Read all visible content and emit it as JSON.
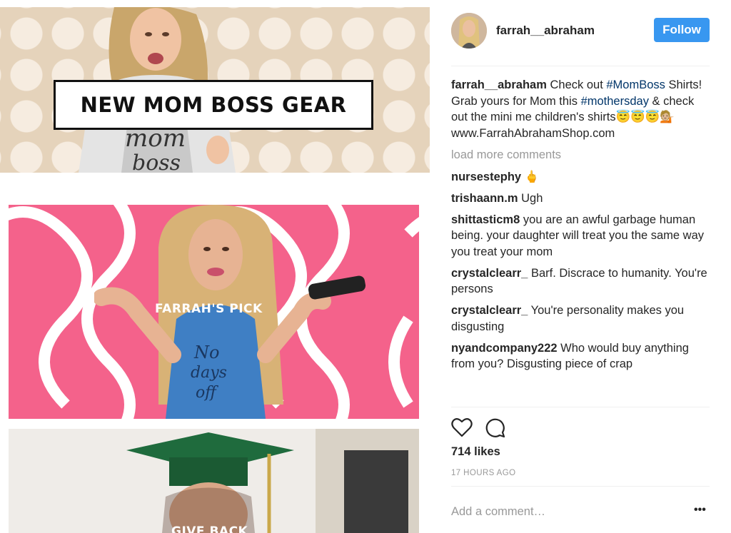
{
  "post": {
    "image": {
      "banner_title": "NEW MOM BOSS GEAR",
      "pick_label": "FARRAH'S PICK",
      "give_label": "GIVE BACK"
    },
    "header": {
      "username": "farrah__abraham",
      "follow_label": "Follow"
    },
    "caption": {
      "username": "farrah__abraham",
      "text_1": " Check out ",
      "hashtag_1": "#MomBoss",
      "text_2": " Shirts! Grab yours for Mom this ",
      "hashtag_2": "#mothersday",
      "text_3": " & check out the mini me children's shirts",
      "emojis": "😇😇😇💁🏼",
      "url": "www.FarrahAbrahamShop.com"
    },
    "load_more": "load more comments",
    "comments": [
      {
        "user": "nursestephy",
        "text": "🖕"
      },
      {
        "user": "trishaann.m",
        "text": "Ugh"
      },
      {
        "user": "shittasticm8",
        "text": "you are an awful garbage human being. your daughter will treat you the same way you treat your mom"
      },
      {
        "user": "crystalclearr_",
        "text": "Barf. Discrace to humanity. You're persons"
      },
      {
        "user": "crystalclearr_",
        "text": "You're personality makes you disgusting"
      },
      {
        "user": "nyandcompany222",
        "text": "Who would buy anything from you? Disgusting piece of crap"
      }
    ],
    "likes": "714 likes",
    "timestamp": "17 HOURS AGO",
    "add_comment_placeholder": "Add a comment…",
    "more_label": "•••",
    "icons": [
      "heart-icon",
      "comment-icon",
      "more-options-icon"
    ],
    "colors": {
      "follow": "#3897f0",
      "hashtag": "#003569",
      "muted": "#999999"
    }
  }
}
